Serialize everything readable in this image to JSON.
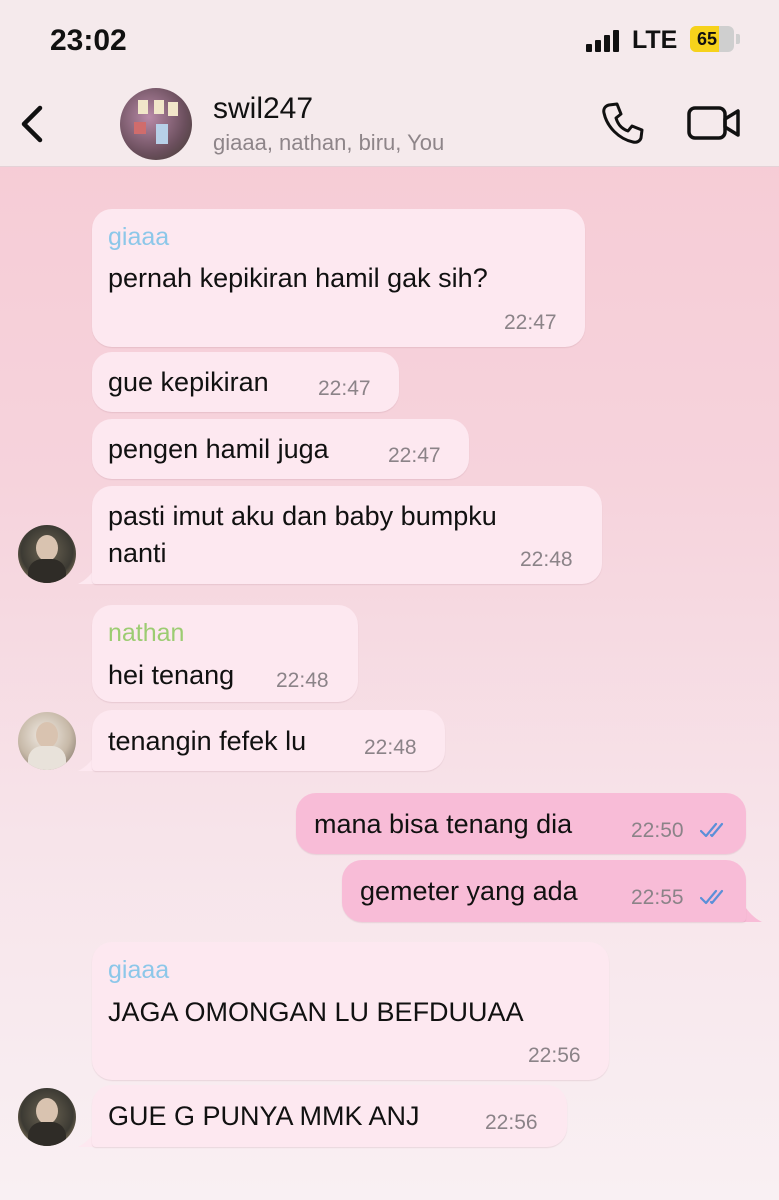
{
  "status_bar": {
    "time": "23:02",
    "network": "LTE",
    "battery": "65",
    "battery_level": 0.65
  },
  "header": {
    "title": "swil247",
    "members": "giaaa, nathan, biru, You"
  },
  "colors": {
    "giaaa": "#8cc7e9",
    "nathan": "#9ccc72",
    "outgoing_bubble": "#f8bcd7",
    "incoming_bubble": "#fde8f0",
    "read_ticks": "#5b8fd8"
  },
  "messages": [
    {
      "sender": "giaaa",
      "text": "pernah kepikiran hamil gak sih?",
      "time": "22:47"
    },
    {
      "text": "gue kepikiran",
      "time": "22:47"
    },
    {
      "text": "pengen hamil juga",
      "time": "22:47"
    },
    {
      "text_line1": "pasti imut aku dan baby bumpku",
      "text_line2": "nanti",
      "time": "22:48"
    },
    {
      "sender": "nathan",
      "text": "hei tenang",
      "time": "22:48"
    },
    {
      "text": "tenangin fefek lu",
      "time": "22:48"
    },
    {
      "text": "mana bisa tenang dia",
      "time": "22:50"
    },
    {
      "text": "gemeter yang ada",
      "time": "22:55"
    },
    {
      "sender": "giaaa",
      "text": "JAGA OMONGAN LU BEFDUUAA",
      "time": "22:56"
    },
    {
      "text": "GUE G PUNYA MMK ANJ",
      "time": "22:56"
    }
  ]
}
